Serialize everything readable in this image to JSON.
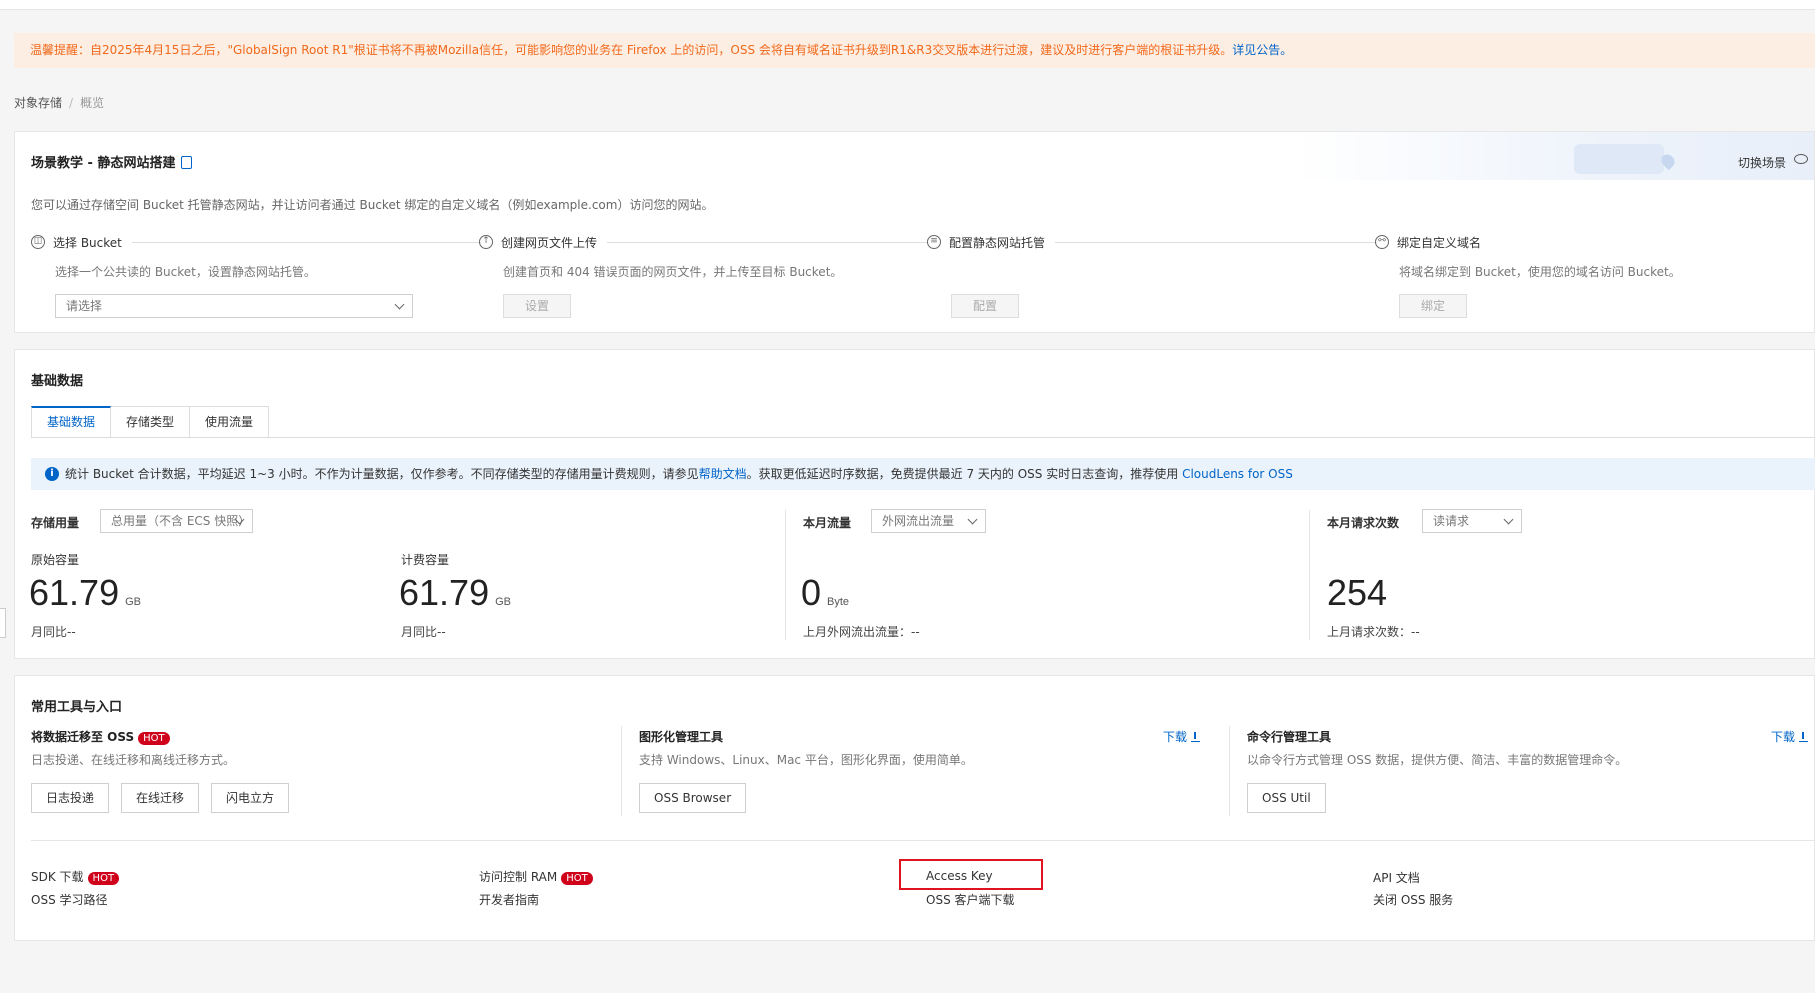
{
  "notice": {
    "text": "温馨提醒：自2025年4月15日之后，\"GlobalSign Root R1\"根证书将不再被Mozilla信任，可能影响您的业务在 Firefox 上的访问，OSS 会将自有域名证书升级到R1&R3交叉版本进行过渡，建议及时进行客户端的根证书升级。",
    "link": "详见公告。"
  },
  "breadcrumb": {
    "root": "对象存储",
    "sep": "/",
    "current": "概览"
  },
  "scene": {
    "title": "场景教学 - 静态网站搭建",
    "switch_label": "切换场景",
    "description": "您可以通过存储空间 Bucket 托管静态网站，并让访问者通过 Bucket 绑定的自定义域名（例如example.com）访问您的网站。",
    "steps": [
      {
        "label": "选择 Bucket",
        "desc": "选择一个公共读的 Bucket，设置静态网站托管。",
        "icon": "bucket-icon"
      },
      {
        "label": "创建网页文件上传",
        "desc": "创建首页和 404 错误页面的网页文件，并上传至目标 Bucket。",
        "button": "设置",
        "icon": "cloud-upload-icon"
      },
      {
        "label": "配置静态网站托管",
        "desc": "",
        "button": "配置",
        "icon": "config-icon"
      },
      {
        "label": "绑定自定义域名",
        "desc": "将域名绑定到 Bucket，使用您的域名访问 Bucket。",
        "button": "绑定",
        "icon": "link-icon"
      }
    ],
    "select_placeholder": "请选择"
  },
  "basic_data": {
    "title": "基础数据",
    "tabs": [
      "基础数据",
      "存储类型",
      "使用流量"
    ],
    "info_text": "统计 Bucket 合计数据，平均延迟 1~3 小时。不作为计量数据，仅作参考。不同存储类型的存储用量计费规则，请参见",
    "info_link1": "帮助文档",
    "info_text2": "。获取更低延迟时序数据，免费提供最近 7 天内的 OSS 实时日志查询，推荐使用",
    "info_link2": "CloudLens for OSS",
    "storage": {
      "label": "存储用量",
      "select": "总用量（不含 ECS 快照）",
      "raw_label": "原始容量",
      "raw_value": "61.79",
      "raw_unit": "GB",
      "raw_note": "月同比--",
      "billed_label": "计费容量",
      "billed_value": "61.79",
      "billed_unit": "GB",
      "billed_note": "月同比--"
    },
    "traffic": {
      "label": "本月流量",
      "select": "外网流出流量",
      "value": "0",
      "unit": "Byte",
      "note": "上月外网流出流量：--"
    },
    "requests": {
      "label": "本月请求次数",
      "select": "读请求",
      "value": "254",
      "note": "上月请求次数：--"
    }
  },
  "tools": {
    "title": "常用工具与入口",
    "migrate": {
      "name": "将数据迁移至 OSS",
      "hot": "HOT",
      "desc": "日志投递、在线迁移和离线迁移方式。",
      "buttons": [
        "日志投递",
        "在线迁移",
        "闪电立方"
      ]
    },
    "gui": {
      "name": "图形化管理工具",
      "desc": "支持 Windows、Linux、Mac 平台，图形化界面，使用简单。",
      "download": "下载",
      "button": "OSS Browser"
    },
    "cli": {
      "name": "命令行管理工具",
      "desc": "以命令行方式管理 OSS 数据，提供方便、简洁、丰富的数据管理命令。",
      "download": "下载",
      "button": "OSS Util"
    },
    "links": {
      "sdk": "SDK 下载",
      "sdk_hot": "HOT",
      "learn": "OSS 学习路径",
      "ram": "访问控制 RAM",
      "ram_hot": "HOT",
      "dev_guide": "开发者指南",
      "access_key": "Access Key",
      "client_download": "OSS 客户端下载",
      "api_doc": "API 文档",
      "close_oss": "关闭 OSS 服务"
    }
  },
  "colors": {
    "accent": "#0064c8",
    "notice_text": "#f1691c",
    "notice_bg": "#fdeee3",
    "hot": "#d0021b",
    "highlight_box": "#e0141e"
  }
}
